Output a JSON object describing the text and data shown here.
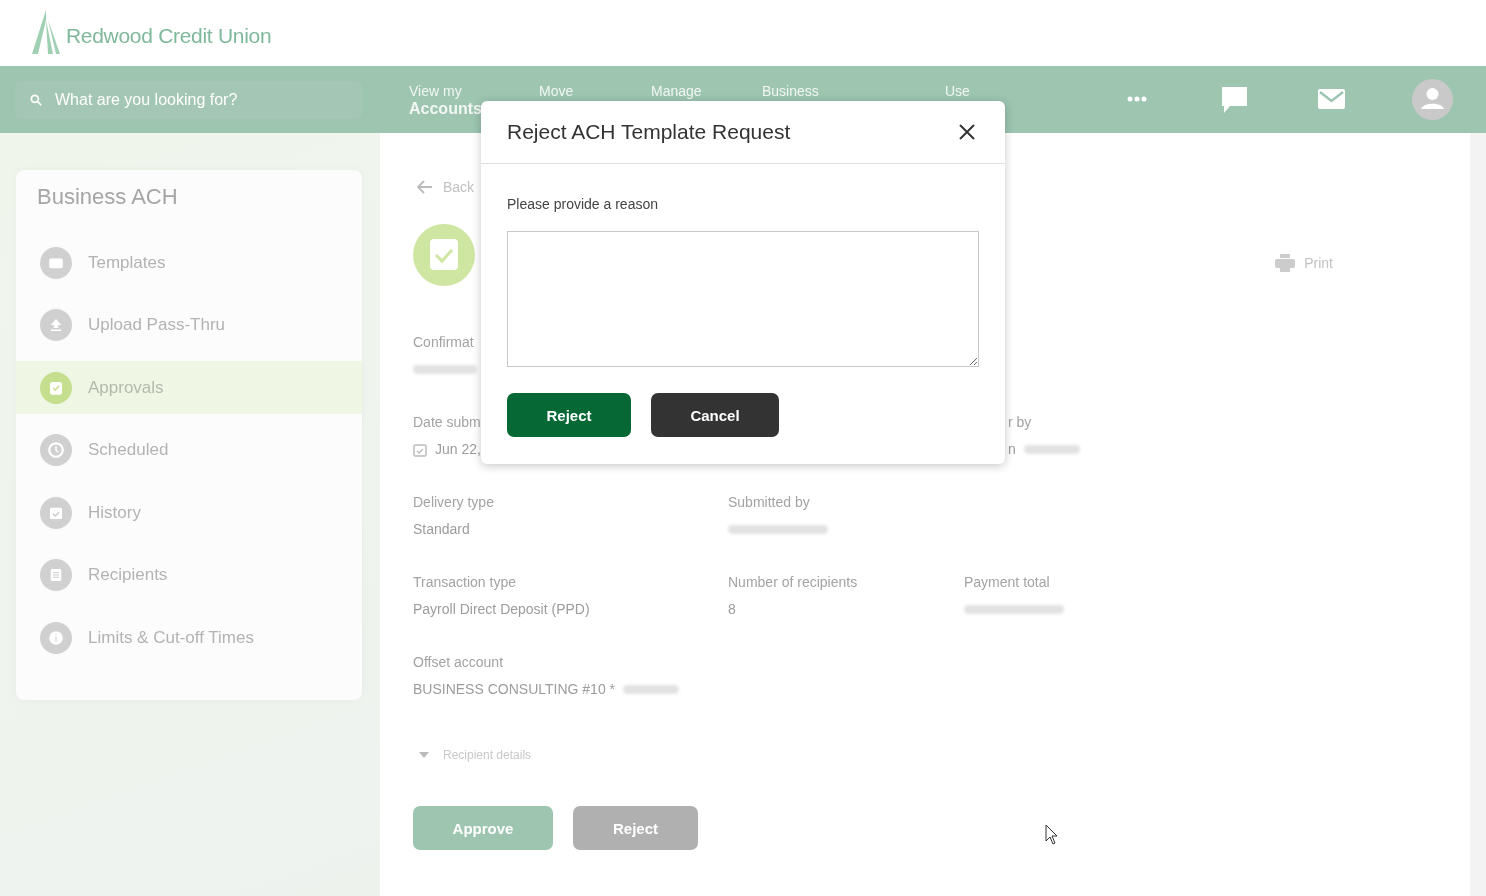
{
  "header": {
    "logo": "Redwood Credit Union"
  },
  "nav": {
    "search": {
      "placeholder": "What are you looking for?"
    },
    "items": [
      {
        "top": "View my",
        "bottom": "Accounts"
      },
      {
        "top": "Move"
      },
      {
        "top": "Manage"
      },
      {
        "top": "Business"
      },
      {
        "top": "Use"
      }
    ]
  },
  "sidebar": {
    "title": "Business ACH",
    "items": [
      {
        "label": "Templates",
        "selected": false
      },
      {
        "label": "Upload Pass-Thru",
        "selected": false
      },
      {
        "label": "Approvals",
        "selected": true
      },
      {
        "label": "Scheduled",
        "selected": false
      },
      {
        "label": "History",
        "selected": false
      },
      {
        "label": "Recipients",
        "selected": false
      },
      {
        "label": "Limits & Cut-off Times",
        "selected": false
      }
    ]
  },
  "main": {
    "back": "Back",
    "print": "Print",
    "rows": [
      {
        "cells": [
          {
            "kind": "plain",
            "label": "Confirmat",
            "redacted": true
          }
        ]
      },
      {
        "cells": [
          {
            "kind": "date",
            "label": "Date subm",
            "value": "Jun 22,"
          },
          "",
          {
            "kind": "partly-covered",
            "label": "r by",
            "value": "n",
            "redacted": true
          }
        ]
      },
      {
        "cells": [
          {
            "kind": "plain",
            "label": "Delivery type",
            "value": "Standard"
          },
          {
            "kind": "plain",
            "label": "Submitted by",
            "redacted": true
          }
        ]
      },
      {
        "cells": [
          {
            "kind": "plain",
            "label": "Transaction type",
            "value": "Payroll Direct Deposit (PPD)"
          },
          {
            "kind": "plain",
            "label": "Number of recipients",
            "value": "8"
          },
          {
            "kind": "plain",
            "label": "Payment total",
            "redacted": true
          }
        ]
      },
      {
        "cells": [
          {
            "kind": "plain",
            "label": "Offset account",
            "value": "BUSINESS CONSULTING #10 *",
            "redacted": true
          }
        ]
      }
    ],
    "details": {
      "label": "Recipient details",
      "expanded": false
    },
    "actions": [
      {
        "label": "Approve",
        "kind": "approve"
      },
      {
        "label": "Reject",
        "kind": "reject"
      }
    ]
  },
  "dialog": {
    "title": "Reject ACH Template Request",
    "prompt": "Please provide a reason",
    "buttons": [
      {
        "label": "Reject",
        "kind": "primary"
      },
      {
        "label": "Cancel",
        "kind": "secondary"
      }
    ]
  }
}
